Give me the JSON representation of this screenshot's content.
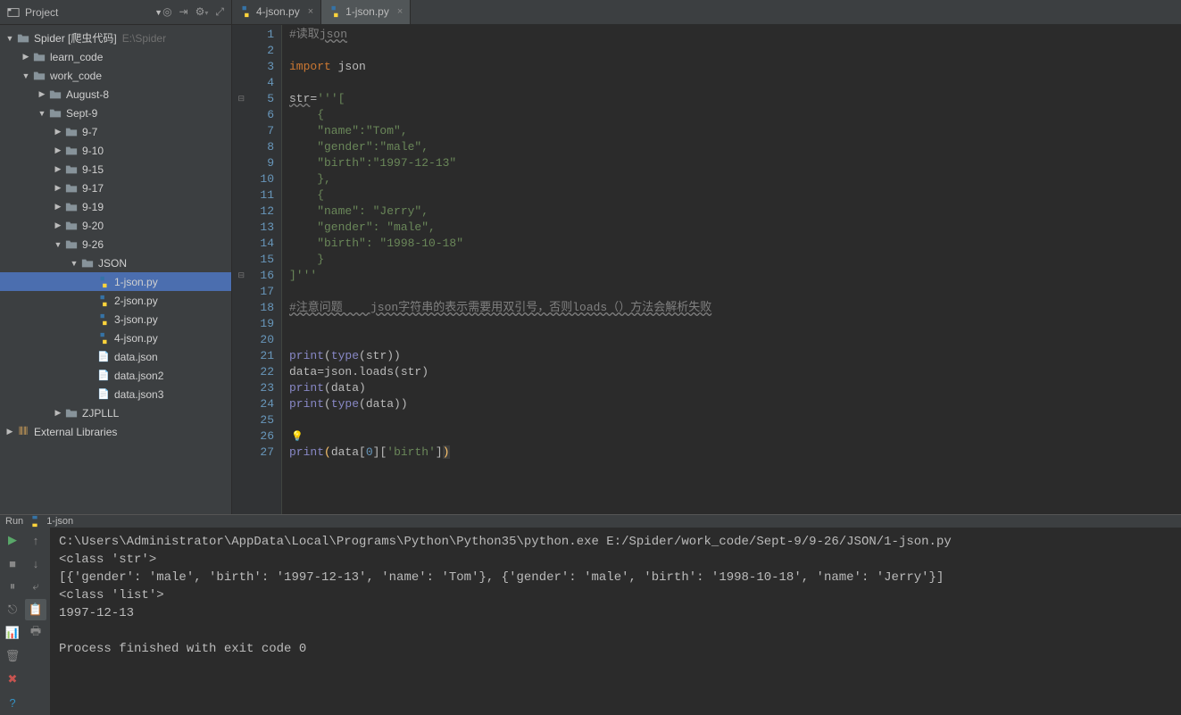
{
  "sidebar": {
    "title": "Project",
    "tree": {
      "root": "Spider [爬虫代码]",
      "root_path": "E:\\Spider",
      "learn_code": "learn_code",
      "work_code": "work_code",
      "august": "August-8",
      "sept": "Sept-9",
      "d97": "9-7",
      "d910": "9-10",
      "d915": "9-15",
      "d917": "9-17",
      "d919": "9-19",
      "d920": "9-20",
      "d926": "9-26",
      "json": "JSON",
      "files": [
        "1-json.py",
        "2-json.py",
        "3-json.py",
        "4-json.py",
        "data.json",
        "data.json2",
        "data.json3"
      ],
      "zjplll": "ZJPLLL",
      "external": "External Libraries"
    }
  },
  "tabs": [
    {
      "label": "4-json.py",
      "active": false
    },
    {
      "label": "1-json.py",
      "active": true
    }
  ],
  "code": {
    "lines": [
      {
        "n": 1,
        "html": "<span class='comment'>#读取<span class='wavy'>json</span></span>"
      },
      {
        "n": 2,
        "html": ""
      },
      {
        "n": 3,
        "html": "<span class='kw'>import </span>json"
      },
      {
        "n": 4,
        "html": ""
      },
      {
        "n": 5,
        "fold": "⊟",
        "html": "<span class='wavy'>str</span>=<span class='str'>'''[</span>"
      },
      {
        "n": 6,
        "html": "<span class='str'>    {</span>"
      },
      {
        "n": 7,
        "html": "<span class='str'>    \"name\":\"Tom\",</span>"
      },
      {
        "n": 8,
        "html": "<span class='str'>    \"gender\":\"male\",</span>"
      },
      {
        "n": 9,
        "html": "<span class='str'>    \"birth\":\"1997-12-13\"</span>"
      },
      {
        "n": 10,
        "html": "<span class='str'>    },</span>"
      },
      {
        "n": 11,
        "html": "<span class='str'>    {</span>"
      },
      {
        "n": 12,
        "html": "<span class='str'>    \"name\": \"Jerry\",</span>"
      },
      {
        "n": 13,
        "html": "<span class='str'>    \"gender\": \"male\",</span>"
      },
      {
        "n": 14,
        "html": "<span class='str'>    \"birth\": \"1998-10-18\"</span>"
      },
      {
        "n": 15,
        "html": "<span class='str'>    }</span>"
      },
      {
        "n": 16,
        "fold": "⊟",
        "html": "<span class='str'>]'''</span>"
      },
      {
        "n": 17,
        "html": ""
      },
      {
        "n": 18,
        "html": "<span class='comment wavy'>#注意问题    json字符串的表示需要用双引号，否则loads（）方法会解析失败</span>"
      },
      {
        "n": 19,
        "html": ""
      },
      {
        "n": 20,
        "html": ""
      },
      {
        "n": 21,
        "html": "<span class='builtin'>print</span>(<span class='builtin'>type</span>(str))"
      },
      {
        "n": 22,
        "html": "data=json.loads(str)"
      },
      {
        "n": 23,
        "html": "<span class='builtin'>print</span>(data)"
      },
      {
        "n": 24,
        "html": "<span class='builtin'>print</span>(<span class='builtin'>type</span>(data))"
      },
      {
        "n": 25,
        "html": ""
      },
      {
        "n": 26,
        "html": "<span class='bulb'>💡</span>"
      },
      {
        "n": 27,
        "html": "<span class='builtin'>print</span><span class='op'>(</span>data[<span class='num'>0</span>][<span class='str'>'birth'</span>]<span class='highlight-bg'><span class='op'>)</span></span>"
      }
    ]
  },
  "run": {
    "label": "Run",
    "config": "1-json",
    "output": "C:\\Users\\Administrator\\AppData\\Local\\Programs\\Python\\Python35\\python.exe E:/Spider/work_code/Sept-9/9-26/JSON/1-json.py\n<class 'str'>\n[{'gender': 'male', 'birth': '1997-12-13', 'name': 'Tom'}, {'gender': 'male', 'birth': '1998-10-18', 'name': 'Jerry'}]\n<class 'list'>\n1997-12-13\n\nProcess finished with exit code 0"
  }
}
